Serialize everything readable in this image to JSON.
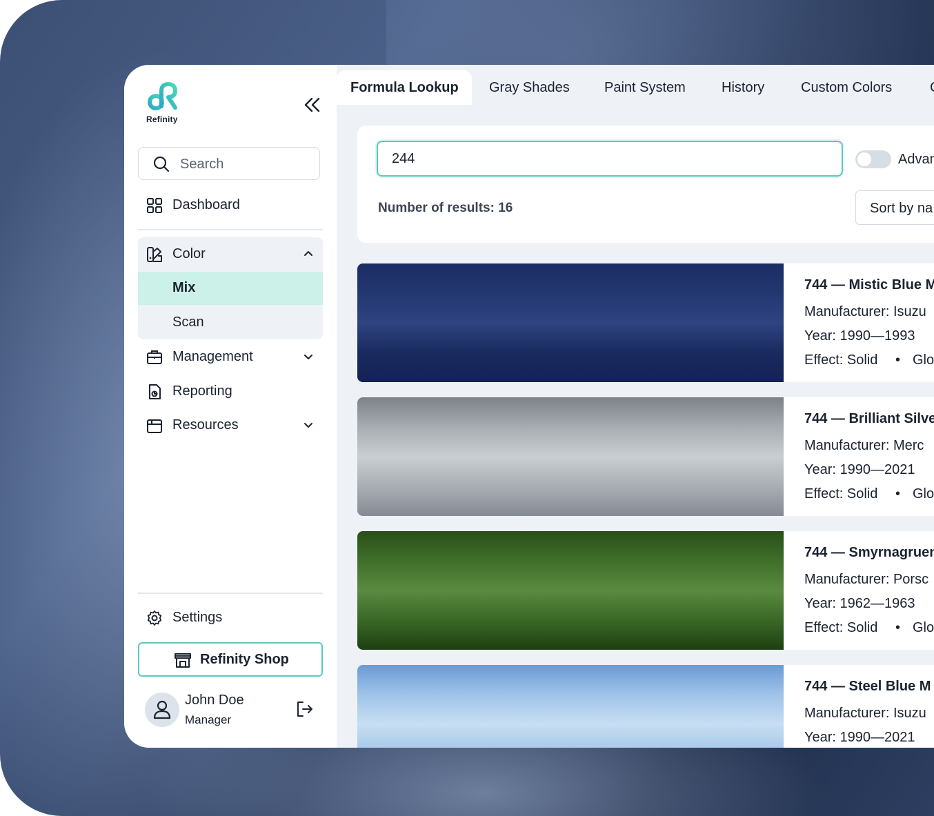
{
  "brand": {
    "name": "Refinity",
    "accent": "#5bc9c0"
  },
  "sidebar": {
    "search_placeholder": "Search",
    "dashboard": "Dashboard",
    "color": {
      "label": "Color",
      "items": [
        {
          "label": "Mix",
          "active": true
        },
        {
          "label": "Scan",
          "active": false
        }
      ]
    },
    "management": "Management",
    "reporting": "Reporting",
    "resources": "Resources",
    "settings": "Settings",
    "shop_button": "Refinity Shop",
    "user": {
      "name": "John Doe",
      "role": "Manager"
    }
  },
  "tabs": [
    {
      "label": "Formula Lookup",
      "active": true
    },
    {
      "label": "Gray Shades",
      "active": false
    },
    {
      "label": "Paint System",
      "active": false
    },
    {
      "label": "History",
      "active": false
    },
    {
      "label": "Custom Colors",
      "active": false
    },
    {
      "label": "C",
      "active": false
    }
  ],
  "lookup": {
    "query": "244",
    "toggle_label": "Advan",
    "results_label": "Number of results: 16",
    "sort_label": "Sort by na"
  },
  "results": [
    {
      "title": "744 — Mistic Blue M",
      "manufacturer": "Manufacturer: Isuzu",
      "year": "Year: 1990—1993",
      "effect": "Effect: Solid",
      "finish": "Glo",
      "colors": [
        "#1b2c63",
        "#233770",
        "#2e4380",
        "#1a2a5e",
        "#142256"
      ]
    },
    {
      "title": "744 — Brilliant Silve",
      "manufacturer": "Manufacturer: Merc",
      "year": "Year: 1990—2021",
      "effect": "Effect: Solid",
      "finish": "Glo",
      "colors": [
        "#7c8188",
        "#a7acb2",
        "#c9ced2",
        "#a9aeb4",
        "#868b93"
      ]
    },
    {
      "title": "744 — Smyrnagruen",
      "manufacturer": "Manufacturer: Porsc",
      "year": "Year: 1962—1963",
      "effect": "Effect: Solid",
      "finish": "Glo",
      "colors": [
        "#2a4f1a",
        "#3f6f2a",
        "#5b8a40",
        "#3a6827",
        "#1e3f12"
      ]
    },
    {
      "title": "744 — Steel Blue M",
      "manufacturer": "Manufacturer: Isuzu",
      "year": "Year: 1990—2021",
      "effect": "",
      "finish": "",
      "colors": [
        "#6a9ad3",
        "#9fc3e8",
        "#c7def3",
        "#a4c6e7",
        "#7aa6d8"
      ]
    }
  ]
}
